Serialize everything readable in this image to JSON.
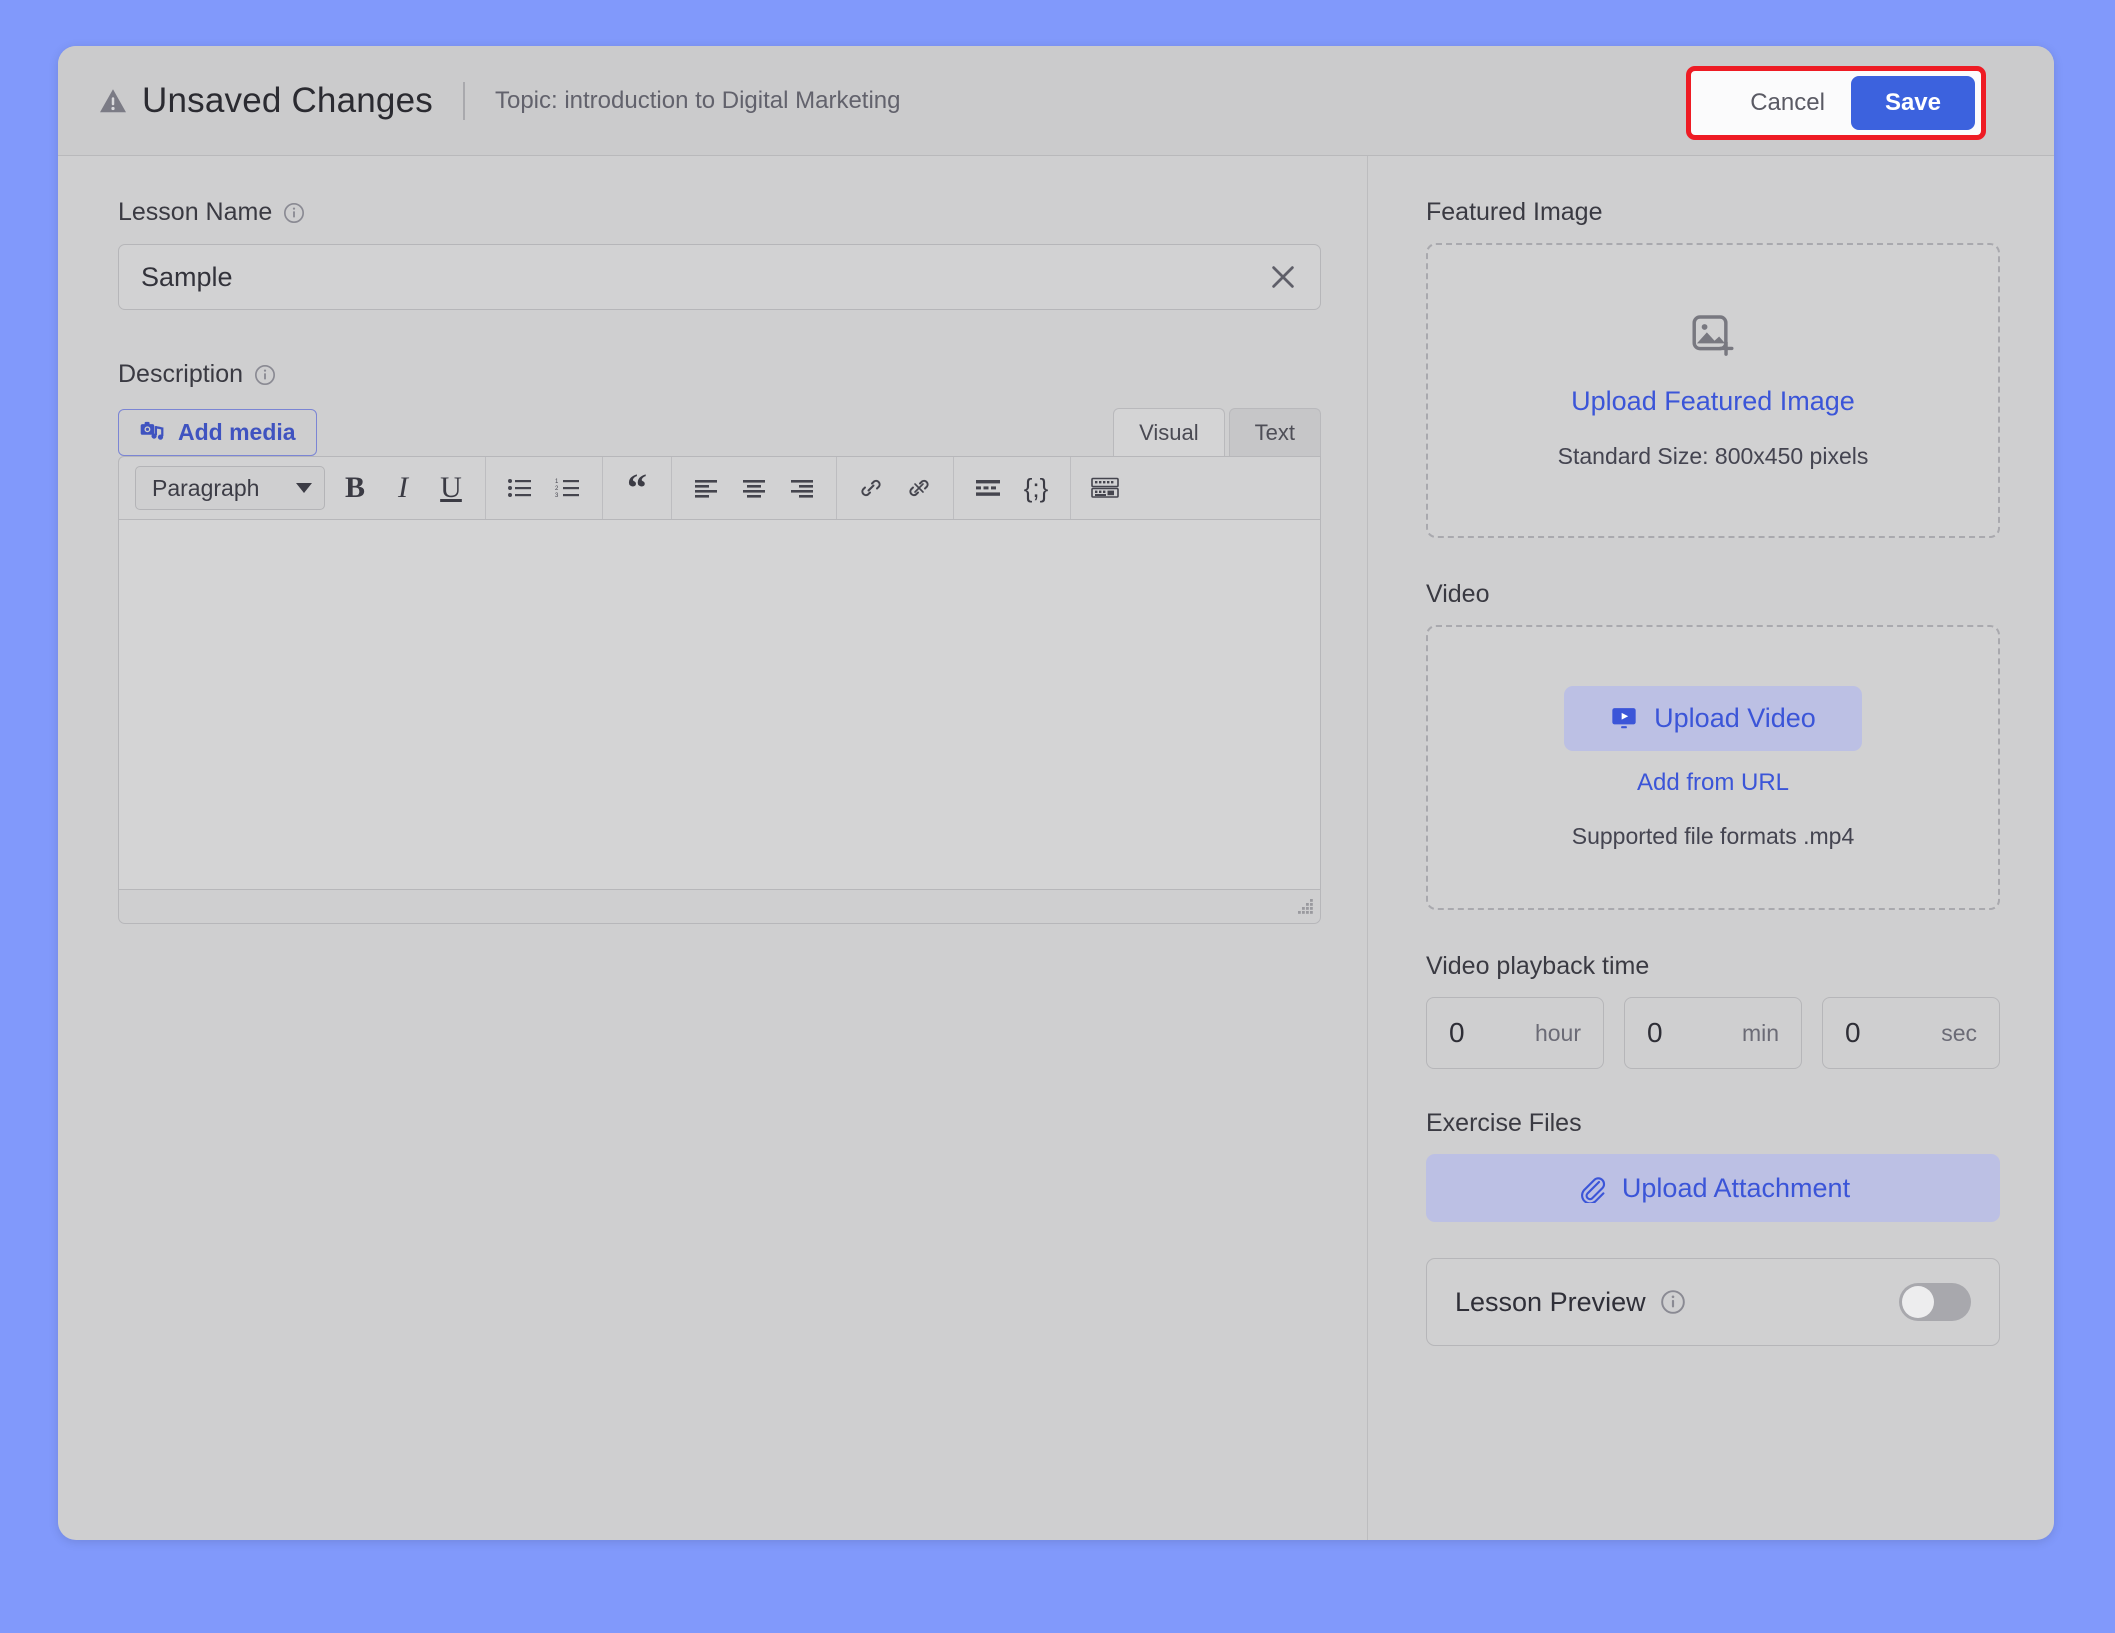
{
  "header": {
    "warning_icon": "warning-triangle-icon",
    "title": "Unsaved Changes",
    "topic": "Topic: introduction to Digital Marketing",
    "cancel_label": "Cancel",
    "save_label": "Save",
    "annotation_color": "#ee1b24",
    "save_color": "#3c62de"
  },
  "left": {
    "lesson_name": {
      "label": "Lesson Name",
      "info_icon": "info-circle-icon",
      "value": "Sample",
      "clear_icon": "close-x-icon"
    },
    "description": {
      "label": "Description",
      "info_icon": "info-circle-icon",
      "add_media_label": "Add media",
      "add_media_icon": "camera-music-icon",
      "tabs": [
        {
          "label": "Visual",
          "active": true
        },
        {
          "label": "Text",
          "active": false
        }
      ],
      "format_select": {
        "value": "Paragraph",
        "caret_icon": "chevron-down-icon"
      },
      "toolbar_buttons": [
        {
          "name": "bold-button",
          "glyph": "B"
        },
        {
          "name": "italic-button",
          "glyph": "I"
        },
        {
          "name": "underline-button",
          "glyph": "U"
        },
        {
          "name": "bulleted-list-button",
          "glyph": ""
        },
        {
          "name": "numbered-list-button",
          "glyph": ""
        },
        {
          "name": "blockquote-button",
          "glyph": "“"
        },
        {
          "name": "align-left-button",
          "glyph": ""
        },
        {
          "name": "align-center-button",
          "glyph": ""
        },
        {
          "name": "align-right-button",
          "glyph": ""
        },
        {
          "name": "insert-link-button",
          "glyph": ""
        },
        {
          "name": "remove-link-button",
          "glyph": ""
        },
        {
          "name": "insert-read-more-button",
          "glyph": ""
        },
        {
          "name": "shortcode-button",
          "glyph": "{;}"
        },
        {
          "name": "keyboard-shortcuts-button",
          "glyph": ""
        }
      ],
      "content": ""
    }
  },
  "right": {
    "featured_image": {
      "label": "Featured Image",
      "icon": "image-add-icon",
      "upload_label": "Upload Featured Image",
      "hint": "Standard Size: 800x450 pixels"
    },
    "video": {
      "label": "Video",
      "upload_label": "Upload Video",
      "upload_icon": "video-play-icon",
      "add_url_label": "Add from URL",
      "hint": "Supported file formats .mp4"
    },
    "playback": {
      "label": "Video playback time",
      "fields": [
        {
          "name": "hour",
          "value": "0",
          "unit": "hour"
        },
        {
          "name": "min",
          "value": "0",
          "unit": "min"
        },
        {
          "name": "sec",
          "value": "0",
          "unit": "sec"
        }
      ]
    },
    "exercise_files": {
      "label": "Exercise Files",
      "upload_label": "Upload Attachment",
      "upload_icon": "paperclip-icon"
    },
    "lesson_preview": {
      "label": "Lesson Preview",
      "info_icon": "info-circle-icon",
      "enabled": false
    }
  }
}
